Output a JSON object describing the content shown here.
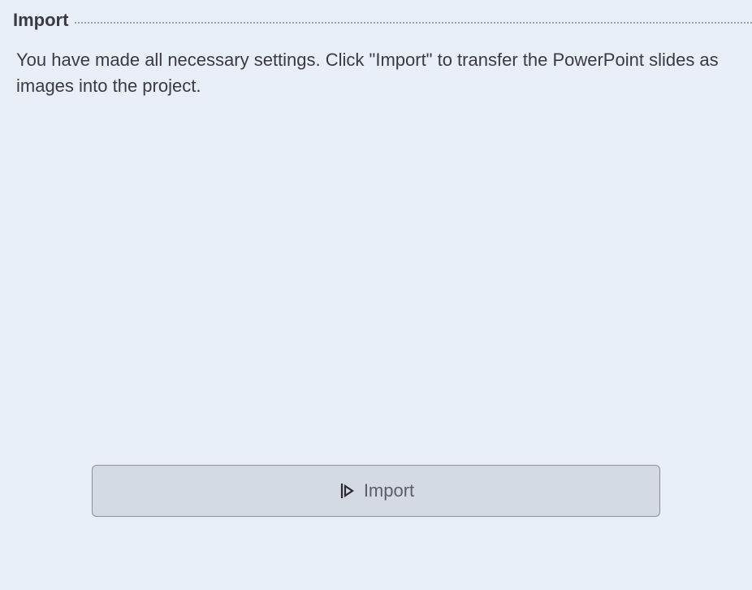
{
  "section": {
    "title": "Import"
  },
  "instruction": {
    "text": "You have made all necessary settings. Click \"Import\" to transfer the PowerPoint slides as images into the project."
  },
  "button": {
    "label": "Import"
  }
}
